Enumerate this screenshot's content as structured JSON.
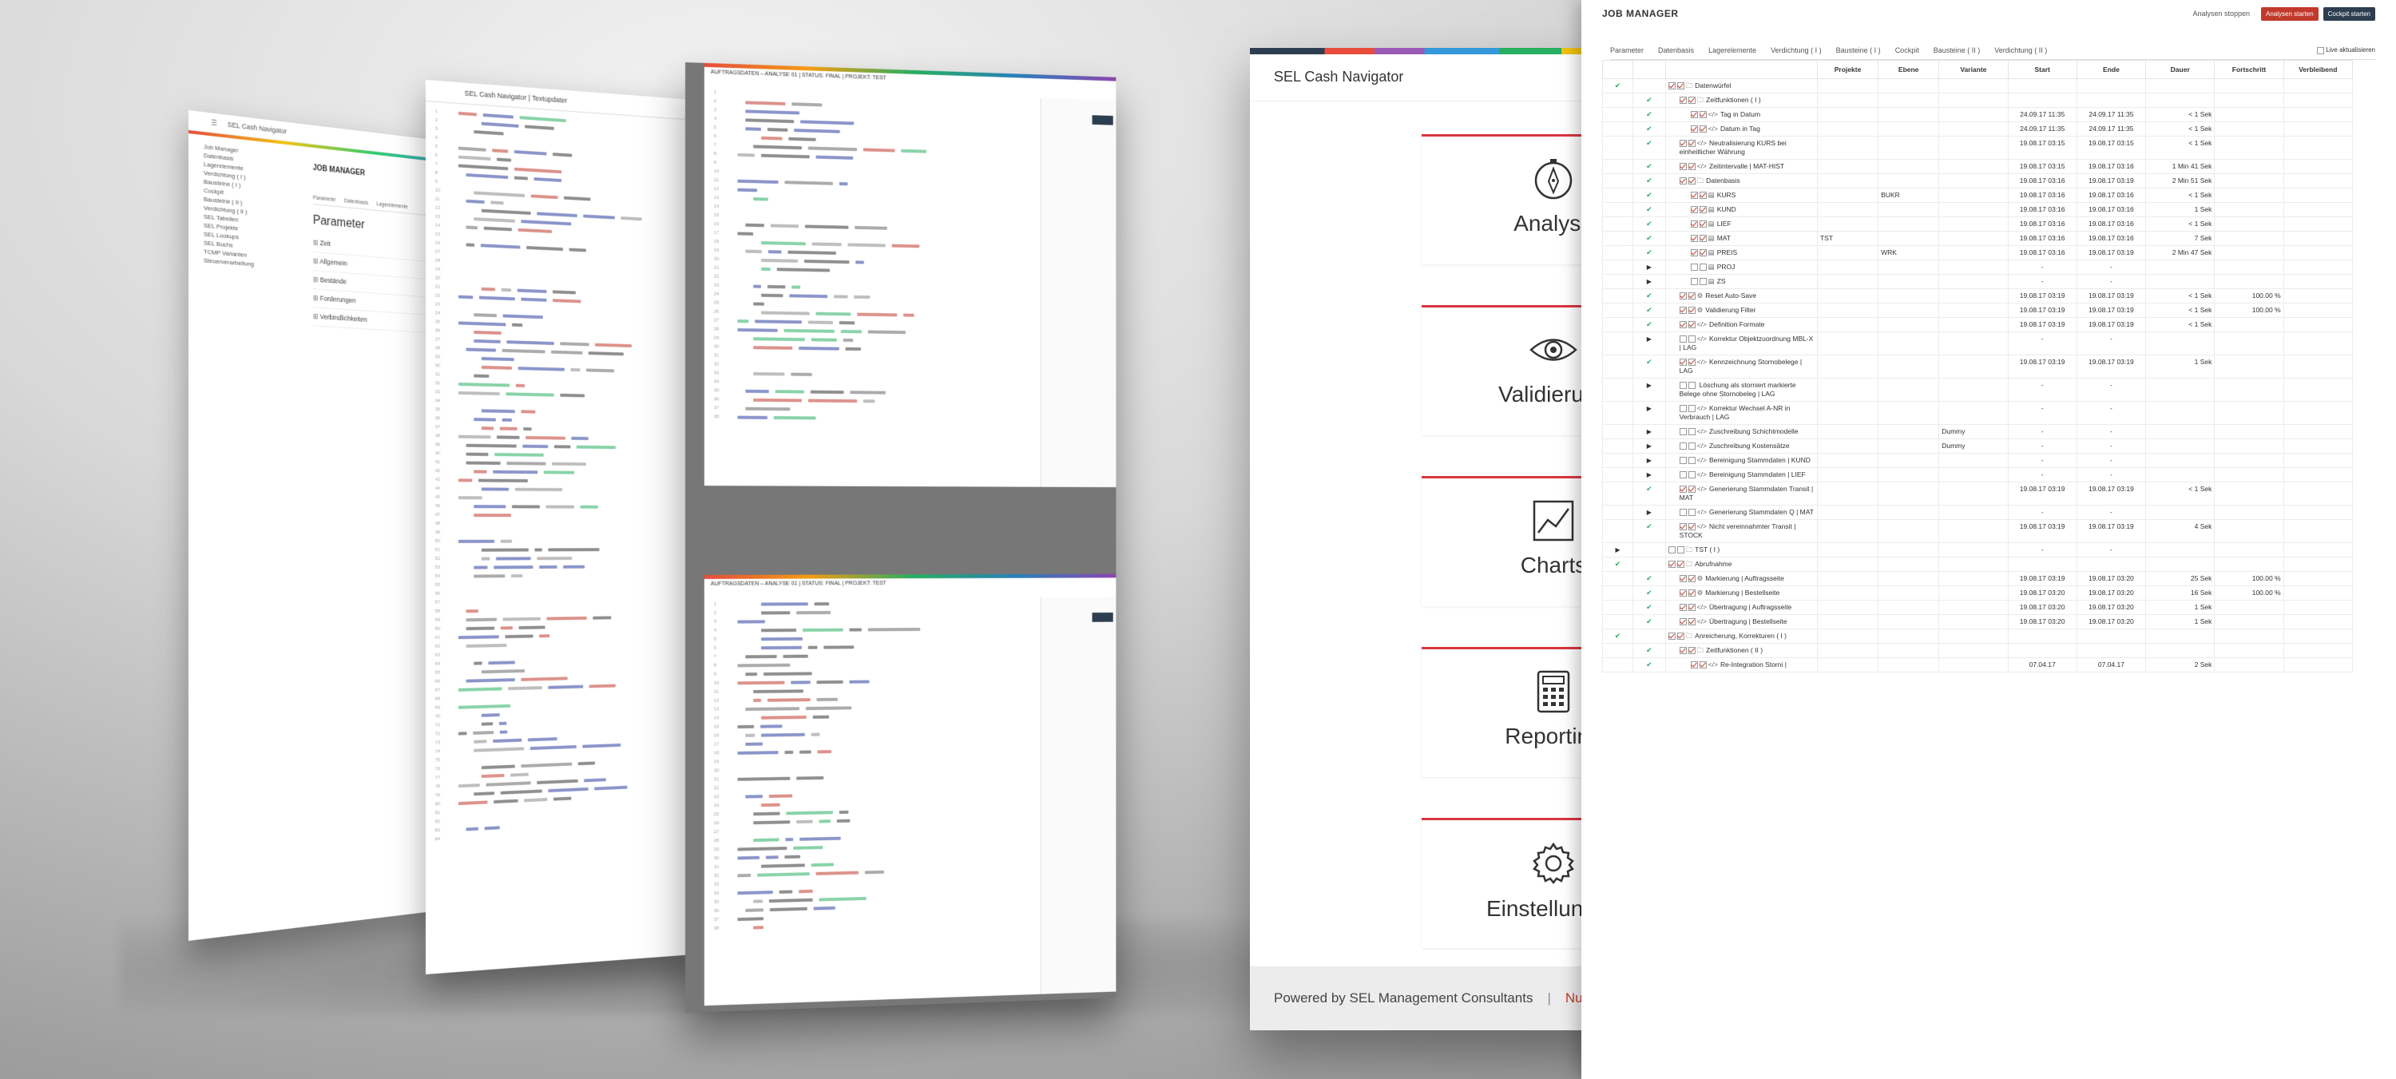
{
  "panel1": {
    "window_title": "SEL Cash Navigator",
    "sidebar": [
      "Job Manager",
      "Datenbasis",
      "Lagerelemente",
      "Verdichtung ( I )",
      "Bausteine ( I )",
      "Cockpit",
      "Bausteine ( II )",
      "Verdichtung ( II )",
      "SEL Tabellen",
      "SEL Projekte",
      "SEL Lookups",
      "SEL Buchs",
      "TCMP Varianten",
      "Steuerverarbeitung"
    ],
    "job_title": "JOB MANAGER",
    "tabs": [
      "Parameter",
      "Datenbasis",
      "Lagerelemente"
    ],
    "section_title": "Parameter",
    "accordion": [
      "Zeit",
      "Allgemein",
      "Bestände",
      "Forderungen",
      "Verbindlichkeiten"
    ]
  },
  "panel2": {
    "window_title": "SEL Cash Navigator | Textupdater"
  },
  "panel3": {
    "window_title": "AUFTRAGSDATEN – ANALYSE 01 | STATUS: FINAL | PROJEKT: TEST"
  },
  "panel4": {
    "title": "SEL Cash Navigator",
    "tiles": [
      "Analyse",
      "Validierung",
      "Charts",
      "Reporting",
      "Einstellungen"
    ],
    "footer_powered": "Powered by SEL Management Consultants",
    "footer_sep": "|",
    "footer_red": "Numbe"
  },
  "jobmanager": {
    "title": "JOB MANAGER",
    "stop_label": "Analysen stoppen",
    "start_label": "Analysen starten",
    "cockpit_label": "Cockpit starten",
    "tabs": [
      "Parameter",
      "Datenbasis",
      "Lagerelemente",
      "Verdichtung ( I )",
      "Bausteine ( I )",
      "Cockpit",
      "Bausteine ( II )",
      "Verdichtung ( II )"
    ],
    "live_label": "Live aktualisieren",
    "columns": [
      "Projekte",
      "Ebene",
      "Variante",
      "Start",
      "Ende",
      "Dauer",
      "Fortschritt",
      "Verbleibend"
    ],
    "rows": [
      {
        "lvl": 0,
        "ok": true,
        "c": [
          true,
          true
        ],
        "icon": "🗀",
        "name": "Datenwürfel",
        "p": "",
        "e": "",
        "v": "",
        "s": "",
        "en": "",
        "d": "",
        "f": "",
        "vb": ""
      },
      {
        "lvl": 1,
        "ok": true,
        "c": [
          true,
          true
        ],
        "icon": "🗀",
        "name": "Zeitfunktionen ( I )",
        "p": "",
        "e": "",
        "v": "",
        "s": "",
        "en": "",
        "d": "",
        "f": "",
        "vb": ""
      },
      {
        "lvl": 2,
        "ok": true,
        "c": [
          true,
          true
        ],
        "icon": "</>",
        "name": "Tag in Datum",
        "p": "",
        "e": "",
        "v": "",
        "s": "24.09.17 11:35",
        "en": "24.09.17 11:35",
        "d": "< 1 Sek",
        "f": "",
        "vb": ""
      },
      {
        "lvl": 2,
        "ok": true,
        "c": [
          true,
          true
        ],
        "icon": "</>",
        "name": "Datum in Tag",
        "p": "",
        "e": "",
        "v": "",
        "s": "24.09.17 11:35",
        "en": "24.09.17 11:35",
        "d": "< 1 Sek",
        "f": "",
        "vb": ""
      },
      {
        "lvl": 1,
        "ok": true,
        "c": [
          true,
          true
        ],
        "icon": "</>",
        "name": "Neutralisierung KURS bei einheitlicher Währung",
        "p": "",
        "e": "",
        "v": "",
        "s": "19.08.17 03:15",
        "en": "19.08.17 03:15",
        "d": "< 1 Sek",
        "f": "",
        "vb": ""
      },
      {
        "lvl": 1,
        "ok": true,
        "c": [
          true,
          true
        ],
        "icon": "</>",
        "name": "Zeitintervalle | MAT-HIST",
        "p": "",
        "e": "",
        "v": "",
        "s": "19.08.17 03:15",
        "en": "19.08.17 03:16",
        "d": "1 Min 41 Sek",
        "f": "",
        "vb": ""
      },
      {
        "lvl": 1,
        "ok": true,
        "c": [
          true,
          true
        ],
        "icon": "🗀",
        "name": "Datenbasis",
        "p": "",
        "e": "",
        "v": "",
        "s": "19.08.17 03:16",
        "en": "19.08.17 03:19",
        "d": "2 Min 51 Sek",
        "f": "",
        "vb": ""
      },
      {
        "lvl": 2,
        "ok": true,
        "c": [
          true,
          true
        ],
        "icon": "▤",
        "name": "KURS",
        "p": "",
        "e": "BUKR",
        "v": "",
        "s": "19.08.17 03:16",
        "en": "19.08.17 03:16",
        "d": "< 1 Sek",
        "f": "",
        "vb": ""
      },
      {
        "lvl": 2,
        "ok": true,
        "c": [
          true,
          true
        ],
        "icon": "▤",
        "name": "KUND",
        "p": "",
        "e": "",
        "v": "",
        "s": "19.08.17 03:16",
        "en": "19.08.17 03:16",
        "d": "1 Sek",
        "f": "",
        "vb": ""
      },
      {
        "lvl": 2,
        "ok": true,
        "c": [
          true,
          true
        ],
        "icon": "▤",
        "name": "LIEF",
        "p": "",
        "e": "",
        "v": "",
        "s": "19.08.17 03:16",
        "en": "19.08.17 03:16",
        "d": "< 1 Sek",
        "f": "",
        "vb": ""
      },
      {
        "lvl": 2,
        "ok": true,
        "c": [
          true,
          true
        ],
        "icon": "▤",
        "name": "MAT",
        "p": "TST",
        "e": "",
        "v": "",
        "s": "19.08.17 03:16",
        "en": "19.08.17 03:16",
        "d": "7 Sek",
        "f": "",
        "vb": ""
      },
      {
        "lvl": 2,
        "ok": true,
        "c": [
          true,
          true
        ],
        "icon": "▤",
        "name": "PREIS",
        "p": "",
        "e": "WRK",
        "v": "",
        "s": "19.08.17 03:16",
        "en": "19.08.17 03:19",
        "d": "2 Min 47 Sek",
        "f": "",
        "vb": ""
      },
      {
        "lvl": 2,
        "ok": false,
        "arrow": true,
        "c": [
          false,
          false
        ],
        "icon": "▤",
        "name": "PROJ",
        "p": "",
        "e": "",
        "v": "",
        "s": "-",
        "en": "-",
        "d": "",
        "f": "",
        "vb": ""
      },
      {
        "lvl": 2,
        "ok": false,
        "arrow": true,
        "c": [
          false,
          false
        ],
        "icon": "▤",
        "name": "ZS",
        "p": "",
        "e": "",
        "v": "",
        "s": "-",
        "en": "-",
        "d": "",
        "f": "",
        "vb": ""
      },
      {
        "lvl": 1,
        "ok": true,
        "c": [
          true,
          true
        ],
        "icon": "⚙",
        "name": "Reset Auto-Save",
        "p": "",
        "e": "",
        "v": "",
        "s": "19.08.17 03:19",
        "en": "19.08.17 03:19",
        "d": "< 1 Sek",
        "f": "100.00 %",
        "vb": ""
      },
      {
        "lvl": 1,
        "ok": true,
        "c": [
          true,
          true
        ],
        "icon": "⚙",
        "name": "Validierung Filter",
        "p": "",
        "e": "",
        "v": "",
        "s": "19.08.17 03:19",
        "en": "19.08.17 03:19",
        "d": "< 1 Sek",
        "f": "100.00 %",
        "vb": ""
      },
      {
        "lvl": 1,
        "ok": true,
        "c": [
          true,
          true
        ],
        "icon": "</>",
        "name": "Definition Formate",
        "p": "",
        "e": "",
        "v": "",
        "s": "19.08.17 03:19",
        "en": "19.08.17 03:19",
        "d": "< 1 Sek",
        "f": "",
        "vb": ""
      },
      {
        "lvl": 1,
        "ok": false,
        "arrow": true,
        "c": [
          false,
          false
        ],
        "icon": "</>",
        "name": "Korrektur Objektzuordnung MBL-X | LAG",
        "p": "",
        "e": "",
        "v": "",
        "s": "-",
        "en": "-",
        "d": "",
        "f": "",
        "vb": ""
      },
      {
        "lvl": 1,
        "ok": true,
        "c": [
          true,
          true
        ],
        "icon": "</>",
        "name": "Kennzeichnung Stornobelege | LAG",
        "p": "",
        "e": "",
        "v": "",
        "s": "19.08.17 03:19",
        "en": "19.08.17 03:19",
        "d": "1 Sek",
        "f": "",
        "vb": ""
      },
      {
        "lvl": 1,
        "ok": false,
        "arrow": true,
        "c": [
          false,
          false
        ],
        "icon": "",
        "name": "Löschung als storniert markierte Belege ohne Stornobeleg | LAG",
        "p": "",
        "e": "",
        "v": "",
        "s": "-",
        "en": "-",
        "d": "",
        "f": "",
        "vb": ""
      },
      {
        "lvl": 1,
        "ok": false,
        "arrow": true,
        "c": [
          false,
          false
        ],
        "icon": "</>",
        "name": "Korrektur Wechsel A-NR in Verbrauch | LAG",
        "p": "",
        "e": "",
        "v": "",
        "s": "-",
        "en": "-",
        "d": "",
        "f": "",
        "vb": ""
      },
      {
        "lvl": 1,
        "ok": false,
        "arrow": true,
        "c": [
          false,
          false
        ],
        "icon": "</>",
        "name": "Zuschreibung Schichtmodelle",
        "p": "",
        "e": "",
        "v": "Dummy",
        "s": "-",
        "en": "-",
        "d": "",
        "f": "",
        "vb": ""
      },
      {
        "lvl": 1,
        "ok": false,
        "arrow": true,
        "c": [
          false,
          false
        ],
        "icon": "</>",
        "name": "Zuschreibung Kostensätze",
        "p": "",
        "e": "",
        "v": "Dummy",
        "s": "-",
        "en": "-",
        "d": "",
        "f": "",
        "vb": ""
      },
      {
        "lvl": 1,
        "ok": false,
        "arrow": true,
        "c": [
          false,
          false
        ],
        "icon": "</>",
        "name": "Bereinigung Stammdaten | KUND",
        "p": "",
        "e": "",
        "v": "",
        "s": "-",
        "en": "-",
        "d": "",
        "f": "",
        "vb": ""
      },
      {
        "lvl": 1,
        "ok": false,
        "arrow": true,
        "c": [
          false,
          false
        ],
        "icon": "</>",
        "name": "Bereinigung Stammdaten | LIEF",
        "p": "",
        "e": "",
        "v": "",
        "s": "-",
        "en": "-",
        "d": "",
        "f": "",
        "vb": ""
      },
      {
        "lvl": 1,
        "ok": true,
        "c": [
          true,
          true
        ],
        "icon": "</>",
        "name": "Generierung Stammdaten Transit | MAT",
        "p": "",
        "e": "",
        "v": "",
        "s": "19.08.17 03:19",
        "en": "19.08.17 03:19",
        "d": "< 1 Sek",
        "f": "",
        "vb": ""
      },
      {
        "lvl": 1,
        "ok": false,
        "arrow": true,
        "c": [
          false,
          false
        ],
        "icon": "</>",
        "name": "Generierung Stammdaten Q | MAT",
        "p": "",
        "e": "",
        "v": "",
        "s": "-",
        "en": "-",
        "d": "",
        "f": "",
        "vb": ""
      },
      {
        "lvl": 1,
        "ok": true,
        "c": [
          true,
          true
        ],
        "icon": "</>",
        "name": "Nicht vereinnahmter Transit | STOCK",
        "p": "",
        "e": "",
        "v": "",
        "s": "19.08.17 03:19",
        "en": "19.08.17 03:19",
        "d": "4 Sek",
        "f": "",
        "vb": ""
      },
      {
        "lvl": 0,
        "ok": false,
        "arrow": true,
        "c": [
          false,
          false
        ],
        "icon": "🗀",
        "name": "TST ( I )",
        "p": "",
        "e": "",
        "v": "",
        "s": "-",
        "en": "-",
        "d": "",
        "f": "",
        "vb": ""
      },
      {
        "lvl": 0,
        "ok": true,
        "c": [
          true,
          true
        ],
        "icon": "🗀",
        "name": "Abrufnahme",
        "p": "",
        "e": "",
        "v": "",
        "s": "",
        "en": "",
        "d": "",
        "f": "",
        "vb": ""
      },
      {
        "lvl": 1,
        "ok": true,
        "c": [
          true,
          true
        ],
        "icon": "⚙",
        "name": "Markierung | Auftragsseite",
        "p": "",
        "e": "",
        "v": "",
        "s": "19.08.17 03:19",
        "en": "19.08.17 03:20",
        "d": "25 Sek",
        "f": "100.00 %",
        "vb": ""
      },
      {
        "lvl": 1,
        "ok": true,
        "c": [
          true,
          true
        ],
        "icon": "⚙",
        "name": "Markierung | Bestellseite",
        "p": "",
        "e": "",
        "v": "",
        "s": "19.08.17 03:20",
        "en": "19.08.17 03:20",
        "d": "16 Sek",
        "f": "100.00 %",
        "vb": ""
      },
      {
        "lvl": 1,
        "ok": true,
        "c": [
          true,
          true
        ],
        "icon": "</>",
        "name": "Übertragung | Auftragsseite",
        "p": "",
        "e": "",
        "v": "",
        "s": "19.08.17 03:20",
        "en": "19.08.17 03:20",
        "d": "1 Sek",
        "f": "",
        "vb": ""
      },
      {
        "lvl": 1,
        "ok": true,
        "c": [
          true,
          true
        ],
        "icon": "</>",
        "name": "Übertragung | Bestellseite",
        "p": "",
        "e": "",
        "v": "",
        "s": "19.08.17 03:20",
        "en": "19.08.17 03:20",
        "d": "1 Sek",
        "f": "",
        "vb": ""
      },
      {
        "lvl": 0,
        "ok": true,
        "c": [
          true,
          true
        ],
        "icon": "🗀",
        "name": "Anreicherung, Korrekturen ( I )",
        "p": "",
        "e": "",
        "v": "",
        "s": "",
        "en": "",
        "d": "",
        "f": "",
        "vb": ""
      },
      {
        "lvl": 1,
        "ok": true,
        "c": [
          true,
          true
        ],
        "icon": "🗀",
        "name": "Zeitfunktionen ( II )",
        "p": "",
        "e": "",
        "v": "",
        "s": "",
        "en": "",
        "d": "",
        "f": "",
        "vb": ""
      },
      {
        "lvl": 2,
        "ok": true,
        "c": [
          true,
          true
        ],
        "icon": "</>",
        "name": "Re-Integration Storni |",
        "p": "",
        "e": "",
        "v": "",
        "s": "07.04.17",
        "en": "07.04.17",
        "d": "2 Sek",
        "f": "",
        "vb": ""
      }
    ]
  }
}
